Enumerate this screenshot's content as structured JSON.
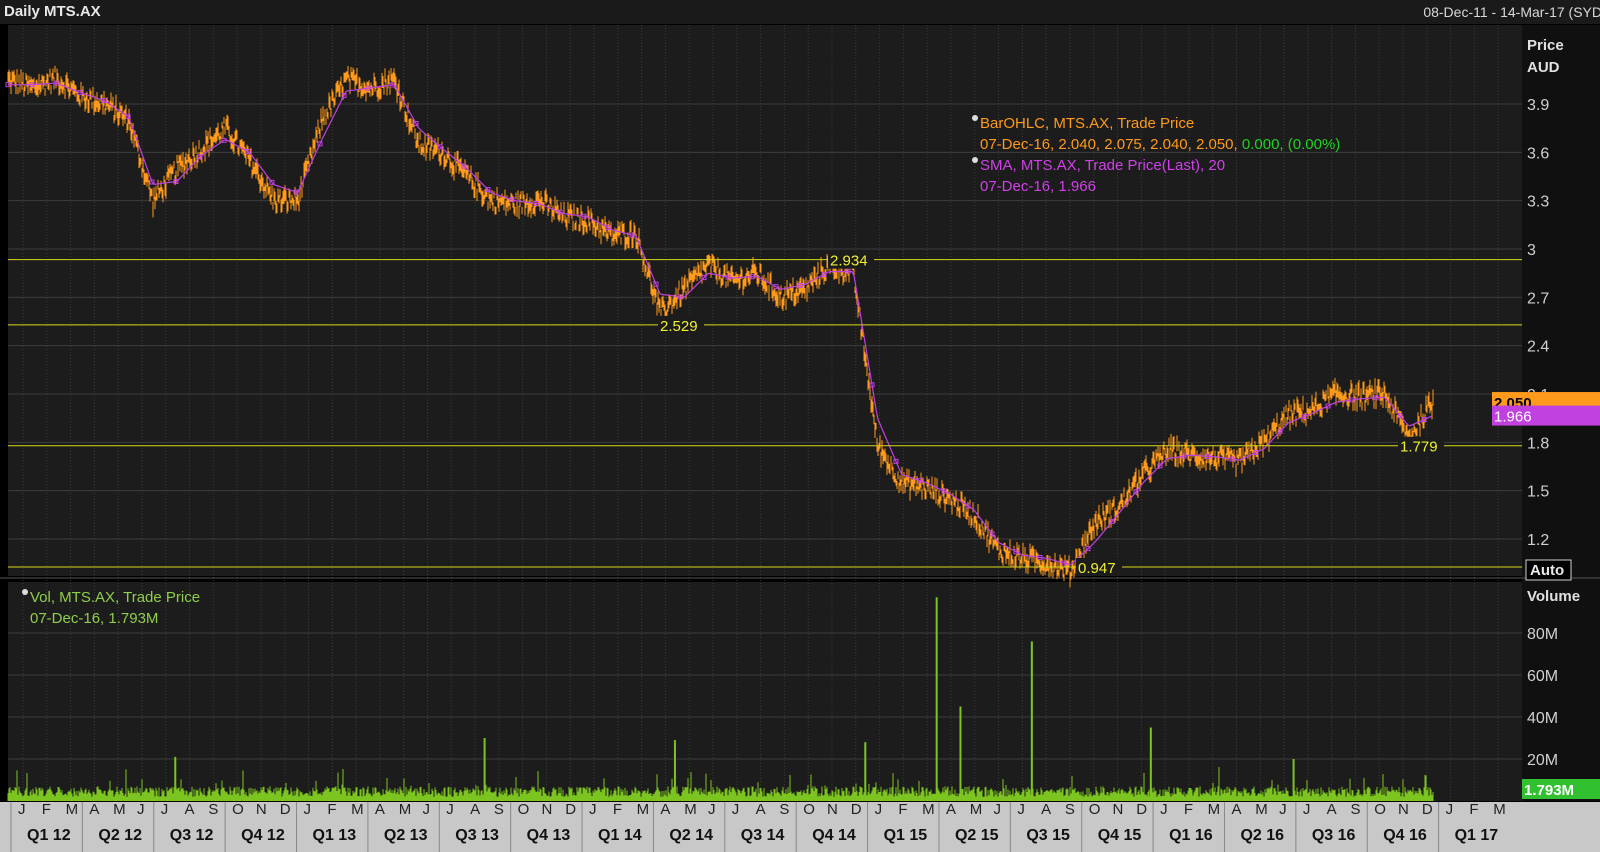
{
  "header": {
    "title": "Daily MTS.AX",
    "date_range": "08-Dec-11 - 14-Mar-17 (SYD"
  },
  "price_axis": {
    "label_line1": "Price",
    "label_line2": "AUD",
    "ticks": [
      "3.9",
      "3.6",
      "3.3",
      "3",
      "2.7",
      "2.4",
      "2.1",
      "1.8",
      "1.5",
      "1.2"
    ],
    "auto_button": "Auto"
  },
  "volume_axis": {
    "label": "Volume",
    "ticks": [
      "80M",
      "60M",
      "40M",
      "20M"
    ],
    "last_badge": "1.793M"
  },
  "legend_price": {
    "series1_name": "BarOHLC, MTS.AX, Trade Price",
    "series1_values": "07-Dec-16, 2.040, 2.075, 2.040, 2.050,",
    "series1_change": "0.000,",
    "series1_change_pct": "(0.00%)",
    "series2_name": "SMA, MTS.AX, Trade Price(Last),  20",
    "series2_values": "07-Dec-16, 1.966"
  },
  "legend_volume": {
    "name": "Vol, MTS.AX, Trade Price",
    "values": "07-Dec-16, 1.793M"
  },
  "badges": {
    "last_price": "2.050",
    "sma_value": "1.966"
  },
  "colors": {
    "price_bars": "#ff9a1a",
    "sma": "#c040e0",
    "volume": "#7cc520",
    "levels": "#d8d81a",
    "grid": "#3c3c3c",
    "background": "#1c1c1c"
  },
  "x_axis": {
    "months": [
      "J",
      "F",
      "M",
      "A",
      "M",
      "J",
      "J",
      "A",
      "S",
      "O",
      "N",
      "D",
      "J",
      "F",
      "M",
      "A",
      "M",
      "J",
      "J",
      "A",
      "S",
      "O",
      "N",
      "D",
      "J",
      "F",
      "M",
      "A",
      "M",
      "J",
      "J",
      "A",
      "S",
      "O",
      "N",
      "D",
      "J",
      "F",
      "M",
      "A",
      "M",
      "J",
      "J",
      "A",
      "S",
      "O",
      "N",
      "D",
      "J",
      "F",
      "M",
      "A",
      "M",
      "J",
      "J",
      "A",
      "S",
      "O",
      "N",
      "D",
      "J",
      "F",
      "M"
    ],
    "quarters": [
      "Q1 12",
      "Q2 12",
      "Q3 12",
      "Q4 12",
      "Q1 13",
      "Q2 13",
      "Q3 13",
      "Q4 13",
      "Q1 14",
      "Q2 14",
      "Q3 14",
      "Q4 14",
      "Q1 15",
      "Q2 15",
      "Q3 15",
      "Q4 15",
      "Q1 16",
      "Q2 16",
      "Q3 16",
      "Q4 16",
      "Q1 17"
    ]
  },
  "chart_data": {
    "type": "line",
    "title": "Daily MTS.AX",
    "ylabel": "Price AUD",
    "ylim": [
      1.05,
      4.0
    ],
    "date_range": [
      "2011-12-08",
      "2017-03-14"
    ],
    "price_series": {
      "name": "BarOHLC, MTS.AX, Trade Price",
      "x": [
        "2012-01",
        "2012-02",
        "2012-03",
        "2012-04",
        "2012-05",
        "2012-06",
        "2012-07",
        "2012-08",
        "2012-09",
        "2012-10",
        "2012-11",
        "2012-12",
        "2013-01",
        "2013-02",
        "2013-03",
        "2013-04",
        "2013-05",
        "2013-06",
        "2013-07",
        "2013-08",
        "2013-09",
        "2013-10",
        "2013-11",
        "2013-12",
        "2014-01",
        "2014-02",
        "2014-03",
        "2014-04",
        "2014-05",
        "2014-06",
        "2014-07",
        "2014-08",
        "2014-09",
        "2014-10",
        "2014-11",
        "2014-12",
        "2015-01",
        "2015-02",
        "2015-03",
        "2015-04",
        "2015-05",
        "2015-06",
        "2015-07",
        "2015-08",
        "2015-09",
        "2015-10",
        "2015-11",
        "2015-12",
        "2016-01",
        "2016-02",
        "2016-03",
        "2016-04",
        "2016-05",
        "2016-06",
        "2016-07",
        "2016-08",
        "2016-09",
        "2016-10",
        "2016-11",
        "2016-12"
      ],
      "close": [
        4.05,
        4.0,
        4.06,
        3.95,
        3.9,
        3.8,
        3.3,
        3.5,
        3.62,
        3.75,
        3.55,
        3.3,
        3.3,
        3.8,
        4.05,
        4.0,
        4.05,
        3.65,
        3.6,
        3.45,
        3.3,
        3.28,
        3.3,
        3.2,
        3.18,
        3.08,
        3.1,
        2.6,
        2.75,
        2.9,
        2.8,
        2.85,
        2.7,
        2.75,
        2.9,
        2.85,
        1.78,
        1.55,
        1.52,
        1.45,
        1.35,
        1.13,
        1.08,
        1.05,
        1.0,
        1.3,
        1.4,
        1.6,
        1.75,
        1.72,
        1.7,
        1.68,
        1.8,
        1.97,
        2.0,
        2.1,
        2.08,
        2.1,
        1.83,
        2.05
      ]
    },
    "sma_series": {
      "name": "SMA, MTS.AX, Trade Price(Last), 20",
      "x": [
        "2012-01",
        "2012-02",
        "2012-03",
        "2012-04",
        "2012-05",
        "2012-06",
        "2012-07",
        "2012-08",
        "2012-09",
        "2012-10",
        "2012-11",
        "2012-12",
        "2013-01",
        "2013-02",
        "2013-03",
        "2013-04",
        "2013-05",
        "2013-06",
        "2013-07",
        "2013-08",
        "2013-09",
        "2013-10",
        "2013-11",
        "2013-12",
        "2014-01",
        "2014-02",
        "2014-03",
        "2014-04",
        "2014-05",
        "2014-06",
        "2014-07",
        "2014-08",
        "2014-09",
        "2014-10",
        "2014-11",
        "2014-12",
        "2015-01",
        "2015-02",
        "2015-03",
        "2015-04",
        "2015-05",
        "2015-06",
        "2015-07",
        "2015-08",
        "2015-09",
        "2015-10",
        "2015-11",
        "2015-12",
        "2016-01",
        "2016-02",
        "2016-03",
        "2016-04",
        "2016-05",
        "2016-06",
        "2016-07",
        "2016-08",
        "2016-09",
        "2016-10",
        "2016-11",
        "2016-12"
      ],
      "values": [
        4.02,
        4.02,
        4.03,
        3.97,
        3.92,
        3.82,
        3.4,
        3.42,
        3.58,
        3.68,
        3.6,
        3.4,
        3.35,
        3.68,
        3.98,
        4.0,
        4.02,
        3.75,
        3.62,
        3.5,
        3.35,
        3.3,
        3.28,
        3.22,
        3.2,
        3.12,
        3.08,
        2.72,
        2.7,
        2.85,
        2.82,
        2.83,
        2.75,
        2.78,
        2.86,
        2.86,
        1.95,
        1.6,
        1.55,
        1.48,
        1.38,
        1.18,
        1.1,
        1.08,
        1.04,
        1.18,
        1.36,
        1.55,
        1.7,
        1.72,
        1.71,
        1.69,
        1.76,
        1.92,
        1.98,
        2.05,
        2.07,
        2.08,
        1.9,
        1.966
      ]
    },
    "levels": [
      {
        "value": 2.934,
        "label": "2.934"
      },
      {
        "value": 2.529,
        "label": "2.529"
      },
      {
        "value": 1.779,
        "label": "1.779"
      },
      {
        "value": 0.947,
        "label": "0.947"
      }
    ],
    "volume": {
      "name": "Vol, MTS.AX, Trade Price",
      "ylim": [
        0,
        100
      ],
      "unit": "M",
      "last": 1.793,
      "spikes": [
        {
          "month": "2012-07",
          "value": 21
        },
        {
          "month": "2013-08",
          "value": 30
        },
        {
          "month": "2014-04",
          "value": 29
        },
        {
          "month": "2014-12",
          "value": 28
        },
        {
          "month": "2015-03",
          "value": 97
        },
        {
          "month": "2015-04",
          "value": 45
        },
        {
          "month": "2015-07",
          "value": 76
        },
        {
          "month": "2015-12",
          "value": 35
        },
        {
          "month": "2016-06",
          "value": 20
        }
      ]
    }
  }
}
